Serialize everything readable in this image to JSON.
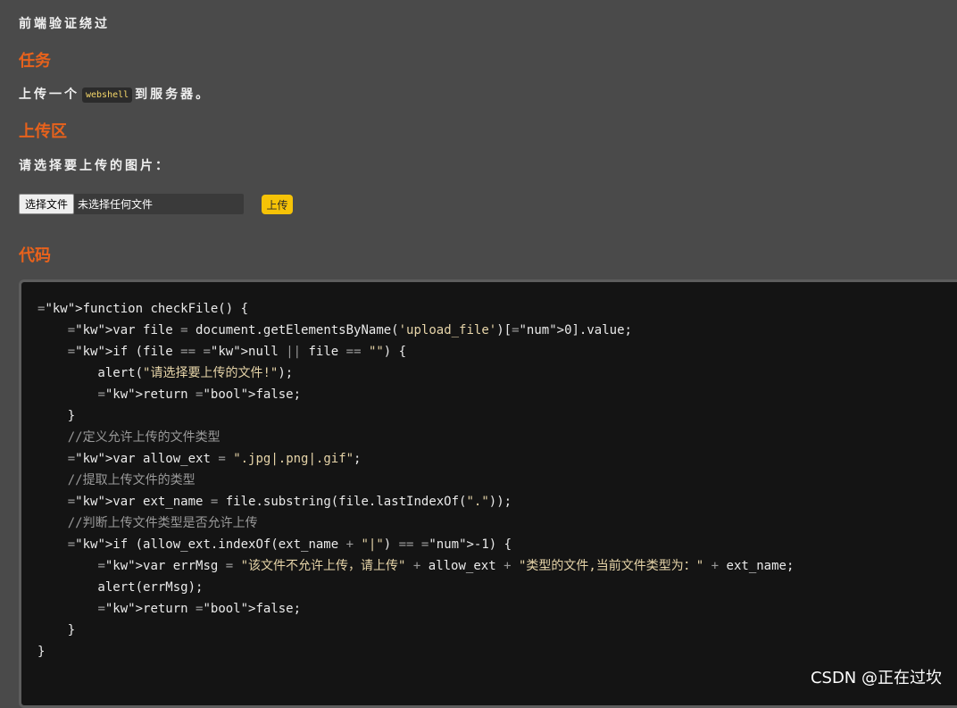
{
  "page": {
    "title": "前端验证绕过"
  },
  "task": {
    "heading": "任务",
    "text_before": "上传一个",
    "code": "webshell",
    "text_after": "到服务器。"
  },
  "upload": {
    "heading": "上传区",
    "prompt": "请选择要上传的图片：",
    "choose_file_label": "选择文件",
    "no_file_text": "未选择任何文件",
    "upload_label": "上传"
  },
  "code_section": {
    "heading": "代码",
    "lines": [
      "function checkFile() {",
      "    var file = document.getElementsByName('upload_file')[0].value;",
      "    if (file == null || file == \"\") {",
      "        alert(\"请选择要上传的文件!\");",
      "        return false;",
      "    }",
      "    //定义允许上传的文件类型",
      "    var allow_ext = \".jpg|.png|.gif\";",
      "    //提取上传文件的类型",
      "    var ext_name = file.substring(file.lastIndexOf(\".\"));",
      "    //判断上传文件类型是否允许上传",
      "    if (allow_ext.indexOf(ext_name + \"|\") == -1) {",
      "        var errMsg = \"该文件不允许上传，请上传\" + allow_ext + \"类型的文件,当前文件类型为：\" + ext_name;",
      "        alert(errMsg);",
      "        return false;",
      "    }",
      "}"
    ]
  },
  "watermark": "CSDN @正在过坎",
  "colors": {
    "background": "#4a4a4a",
    "heading": "#e8621c",
    "upload_button": "#f6c307",
    "code_background": "#141414"
  }
}
